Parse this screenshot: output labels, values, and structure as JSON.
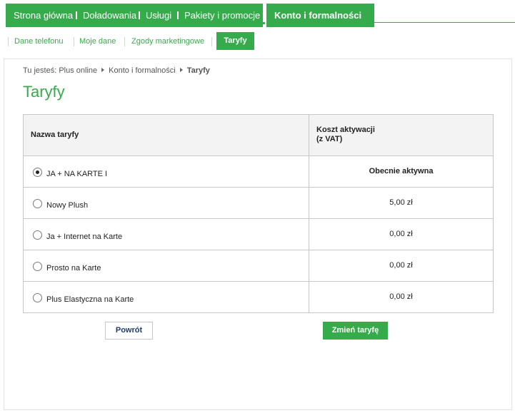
{
  "topnav": {
    "items": [
      {
        "label": "Strona główna"
      },
      {
        "label": "Doładowania"
      },
      {
        "label": "Usługi"
      },
      {
        "label": "Pakiety i promocje"
      }
    ],
    "active_label": "Konto i formalności"
  },
  "subnav": {
    "items": [
      {
        "label": "Dane telefonu"
      },
      {
        "label": "Moje dane"
      },
      {
        "label": "Zgody marketingowe"
      }
    ],
    "active_label": "Taryfy"
  },
  "breadcrumb": {
    "prefix": "Tu jesteś:",
    "items": [
      "Plus online",
      "Konto i formalności"
    ],
    "current": "Taryfy"
  },
  "page_title": "Taryfy",
  "table": {
    "headers": {
      "name": "Nazwa taryfy",
      "cost": "Koszt aktywacji\n(z VAT)"
    },
    "rows": [
      {
        "name": "JA + NA KARTE I",
        "cost": "Obecnie aktywna",
        "selected": true
      },
      {
        "name": "Nowy Plush",
        "cost": "5,00 zł",
        "selected": false
      },
      {
        "name": "Ja + Internet na Karte",
        "cost": "0,00 zł",
        "selected": false
      },
      {
        "name": "Prosto na Karte",
        "cost": "0,00 zł",
        "selected": false
      },
      {
        "name": "Plus Elastyczna na Karte",
        "cost": "0,00 zł",
        "selected": false
      }
    ]
  },
  "buttons": {
    "back_label": "Powrót",
    "change_label": "Zmień taryfę"
  },
  "colors": {
    "accent": "#35ab4b",
    "link": "#35ab4b",
    "button_text_dark": "#1d3d6d"
  }
}
